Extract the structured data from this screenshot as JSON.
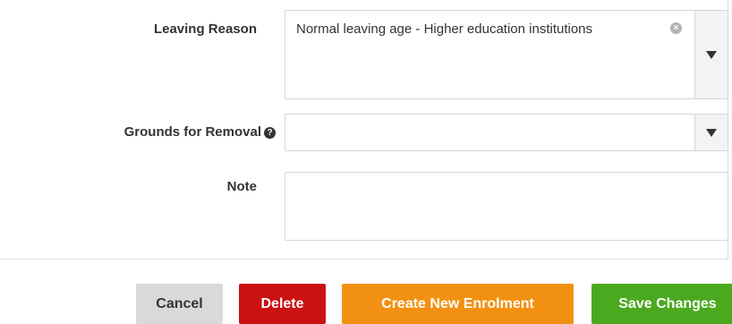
{
  "form": {
    "leaving_reason": {
      "label": "Leaving Reason",
      "value": "Normal leaving age - Higher education institutions",
      "clear_glyph": "×"
    },
    "grounds_for_removal": {
      "label": "Grounds for Removal",
      "help_glyph": "?",
      "value": ""
    },
    "note": {
      "label": "Note",
      "value": ""
    }
  },
  "actions": {
    "cancel_label": "Cancel",
    "delete_label": "Delete",
    "create_label": "Create New Enrolment",
    "save_label": "Save Changes"
  },
  "colors": {
    "cancel": "#d9d9d9",
    "delete": "#cc1111",
    "create": "#f29111",
    "save": "#4ba91f"
  }
}
